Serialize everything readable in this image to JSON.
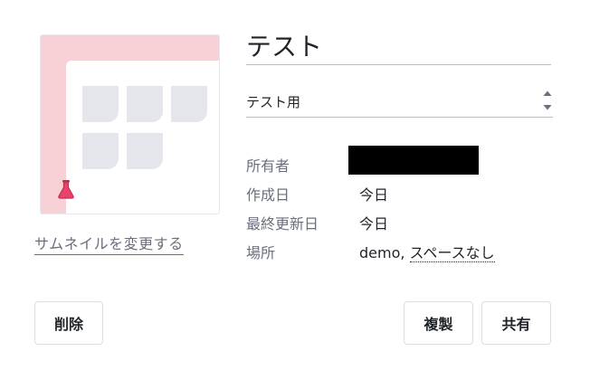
{
  "title": {
    "value": "テスト"
  },
  "category_select": {
    "selected": "テスト用"
  },
  "thumbnail": {
    "change_label": "サムネイルを変更する",
    "background_color": "#f7d1d6",
    "tile_color": "#e5e6ec",
    "badge_icon": "flask-icon",
    "badge_color": "#e8436b"
  },
  "meta": {
    "owner_label": "所有者",
    "owner_value": "",
    "created_label": "作成日",
    "created_value": "今日",
    "updated_label": "最終更新日",
    "updated_value": "今日",
    "location_label": "場所",
    "location_prefix": "demo, ",
    "location_link": "スペースなし"
  },
  "buttons": {
    "delete": "削除",
    "duplicate": "複製",
    "share": "共有"
  }
}
